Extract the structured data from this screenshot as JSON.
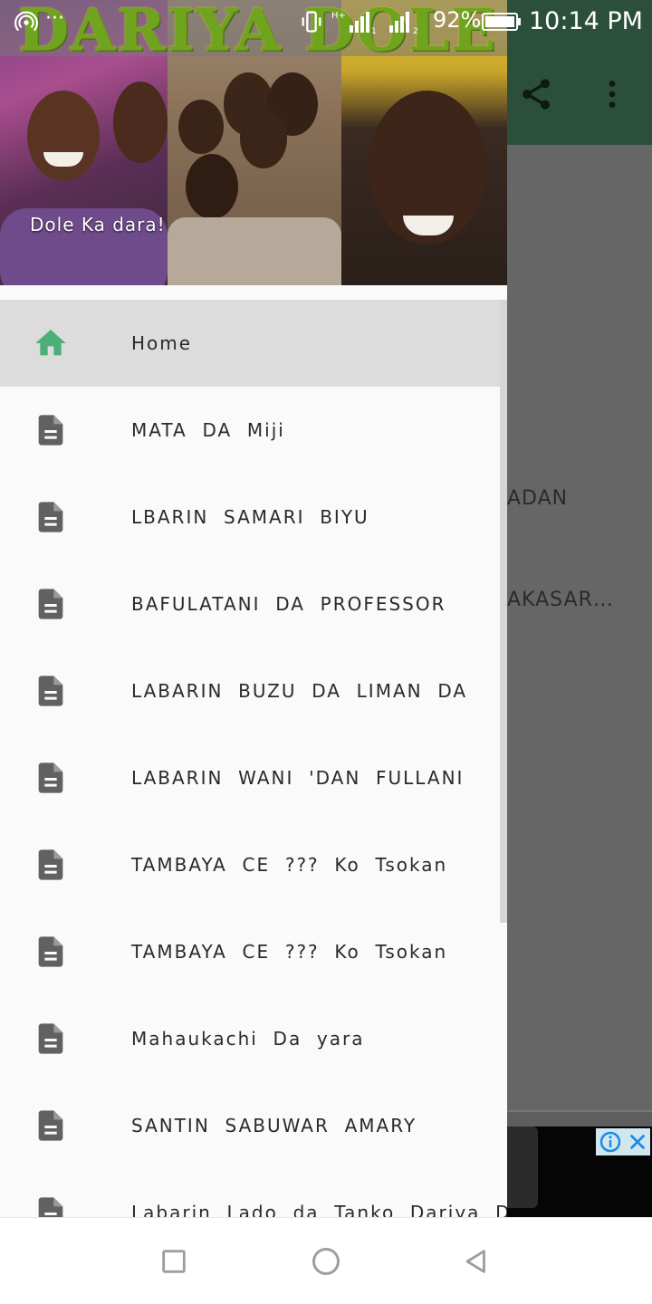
{
  "status_bar": {
    "battery_percent": "92%",
    "time": "10:14 PM",
    "icons": [
      "hotspot-icon",
      "overflow-dots-icon",
      "vibrate-icon",
      "signal-h-plus-icon",
      "signal-2-icon",
      "battery-icon"
    ]
  },
  "app_bar": {
    "actions": [
      "share-icon",
      "more-vert-icon"
    ]
  },
  "background_list": {
    "items": [
      "ADAN",
      "AKASAR…"
    ]
  },
  "drawer": {
    "logo": "DARIYA DOLE",
    "tagline": "Dole  Ka  dara!",
    "menu": [
      {
        "label": "Home",
        "icon": "home-icon",
        "active": true
      },
      {
        "label": "MATA  DA  Miji",
        "icon": "document-icon"
      },
      {
        "label": "LBARIN  SAMARI  BIYU",
        "icon": "document-icon"
      },
      {
        "label": "BAFULATANI  DA  PROFESSOR",
        "icon": "document-icon"
      },
      {
        "label": "LABARIN  BUZU  DA  LIMAN  DA",
        "icon": "document-icon"
      },
      {
        "label": "LABARIN  WANI  'DAN  FULLANI",
        "icon": "document-icon"
      },
      {
        "label": "TAMBAYA  CE  ???  Ko  Tsokan",
        "icon": "document-icon"
      },
      {
        "label": "TAMBAYA  CE  ???  Ko  Tsokan",
        "icon": "document-icon"
      },
      {
        "label": "Mahaukachi  Da  yara",
        "icon": "document-icon"
      },
      {
        "label": "SANTIN  SABUWAR  AMARY",
        "icon": "document-icon"
      },
      {
        "label": "Labarin  Lado  da  Tanko  Dariya  D",
        "icon": "document-icon"
      }
    ]
  },
  "ad": {
    "icons": [
      "info-icon",
      "close-icon"
    ]
  },
  "nav_bar": {
    "buttons": [
      "recents-icon",
      "home-circle-icon",
      "back-icon"
    ]
  },
  "colors": {
    "app_bar": "#2c4f3c",
    "home_icon": "#4caf78",
    "doc_icon": "#616161",
    "drawer_bg": "#fafafa",
    "active_item_bg": "#dcdcdc"
  }
}
